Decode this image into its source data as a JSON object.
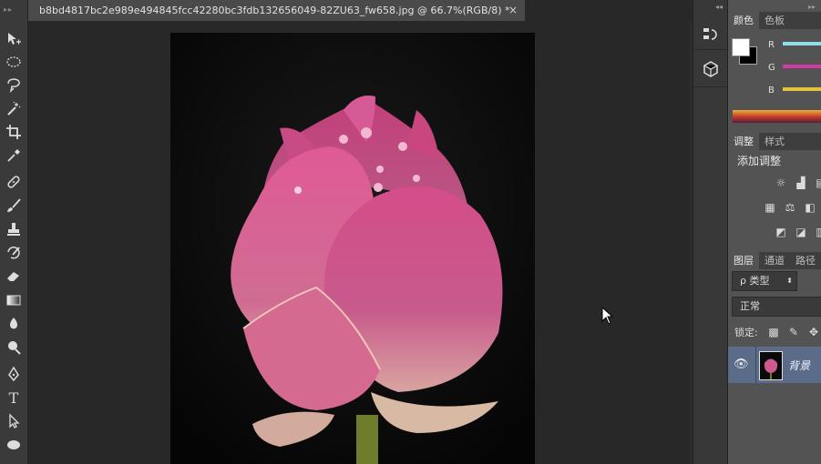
{
  "document": {
    "tab_title": "b8bd4817bc2e989e494845fcc42280bc3fdb132656049-82ZU63_fw658.jpg @ 66.7%(RGB/8) *",
    "close_symbol": "×"
  },
  "toolbar": {
    "tools": [
      "move-tool",
      "marquee-tool",
      "lasso-tool",
      "magic-wand-tool",
      "crop-tool",
      "eyedropper-tool",
      "healing-brush-tool",
      "brush-tool",
      "clone-stamp-tool",
      "history-brush-tool",
      "eraser-tool",
      "gradient-tool",
      "blur-tool",
      "dodge-tool",
      "pen-tool",
      "type-tool",
      "path-selection-tool",
      "ellipse-tool"
    ],
    "type_glyph": "T"
  },
  "color_panel": {
    "tabs": [
      "颜色",
      "色板"
    ],
    "channels": [
      "R",
      "G",
      "B"
    ],
    "colors": {
      "r": "#8ee0e6",
      "g": "#d23aa8",
      "b": "#e4c23a",
      "foreground": "#ffffff",
      "background": "#000000"
    }
  },
  "adjust_panel": {
    "tabs": [
      "调整",
      "样式"
    ],
    "title": "添加调整"
  },
  "layers_panel": {
    "tabs": [
      "图层",
      "通道",
      "路径"
    ],
    "filter_label": "ρ 类型",
    "blend_mode": "正常",
    "lock_label": "锁定:",
    "layer_name": "背景"
  }
}
